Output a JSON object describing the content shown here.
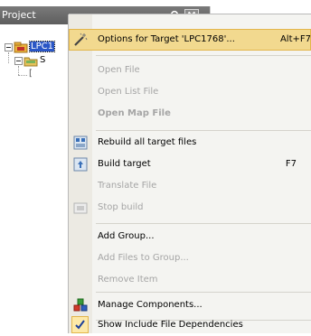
{
  "pane": {
    "title": "Project"
  },
  "tree": {
    "root_label": "LPC1",
    "child_label": "S",
    "grandchild_label": "["
  },
  "menu": {
    "items": [
      {
        "label": "Options for Target 'LPC1768'...",
        "shortcut": "Alt+F7",
        "state": "highlighted",
        "icon": "magic-wand-icon"
      },
      {
        "label": "Open File",
        "state": "disabled"
      },
      {
        "label": "Open List File",
        "state": "disabled"
      },
      {
        "label": "Open Map File",
        "state": "disabled"
      },
      {
        "label": "Rebuild all target files",
        "state": "enabled",
        "icon": "rebuild-icon"
      },
      {
        "label": "Build target",
        "shortcut": "F7",
        "state": "enabled",
        "icon": "build-icon"
      },
      {
        "label": "Translate File",
        "state": "disabled"
      },
      {
        "label": "Stop build",
        "state": "disabled",
        "icon": "stop-build-icon"
      },
      {
        "label": "Add Group...",
        "state": "enabled"
      },
      {
        "label": "Add Files to Group...",
        "state": "disabled"
      },
      {
        "label": "Remove Item",
        "state": "disabled"
      },
      {
        "label": "Manage Components...",
        "state": "enabled",
        "icon": "components-icon"
      },
      {
        "label": "Show Include File Dependencies",
        "state": "checked",
        "icon": "checkmark-icon"
      }
    ]
  },
  "colors": {
    "highlight": "#f2d98f",
    "highlight_border": "#e2b54a",
    "disabled_text": "#a5a5a5",
    "tree_selection": "#2a56c6",
    "pane_header": "#6b6b6b"
  }
}
